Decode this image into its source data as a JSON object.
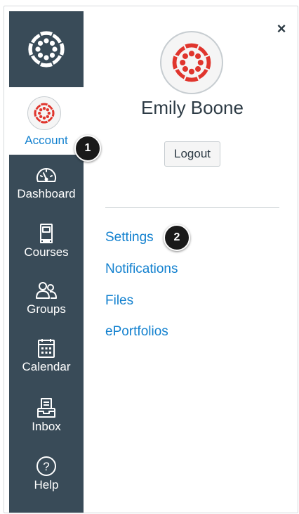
{
  "nav": {
    "account_label": "Account",
    "items": [
      {
        "label": "Dashboard",
        "icon": "dashboard-icon"
      },
      {
        "label": "Courses",
        "icon": "courses-icon"
      },
      {
        "label": "Groups",
        "icon": "groups-icon"
      },
      {
        "label": "Calendar",
        "icon": "calendar-icon"
      },
      {
        "label": "Inbox",
        "icon": "inbox-icon"
      },
      {
        "label": "Help",
        "icon": "help-icon"
      }
    ]
  },
  "tray": {
    "close_label": "×",
    "user_name": "Emily Boone",
    "logout_label": "Logout",
    "links": [
      {
        "label": "Settings"
      },
      {
        "label": "Notifications"
      },
      {
        "label": "Files"
      },
      {
        "label": "ePortfolios"
      }
    ]
  },
  "badges": {
    "one": "1",
    "two": "2"
  },
  "colors": {
    "nav_background": "#394b58",
    "link_blue": "#1381cf",
    "canvas_red": "#e0352d",
    "text_dark": "#2d3b45",
    "badge_black": "#1a1a1a"
  }
}
